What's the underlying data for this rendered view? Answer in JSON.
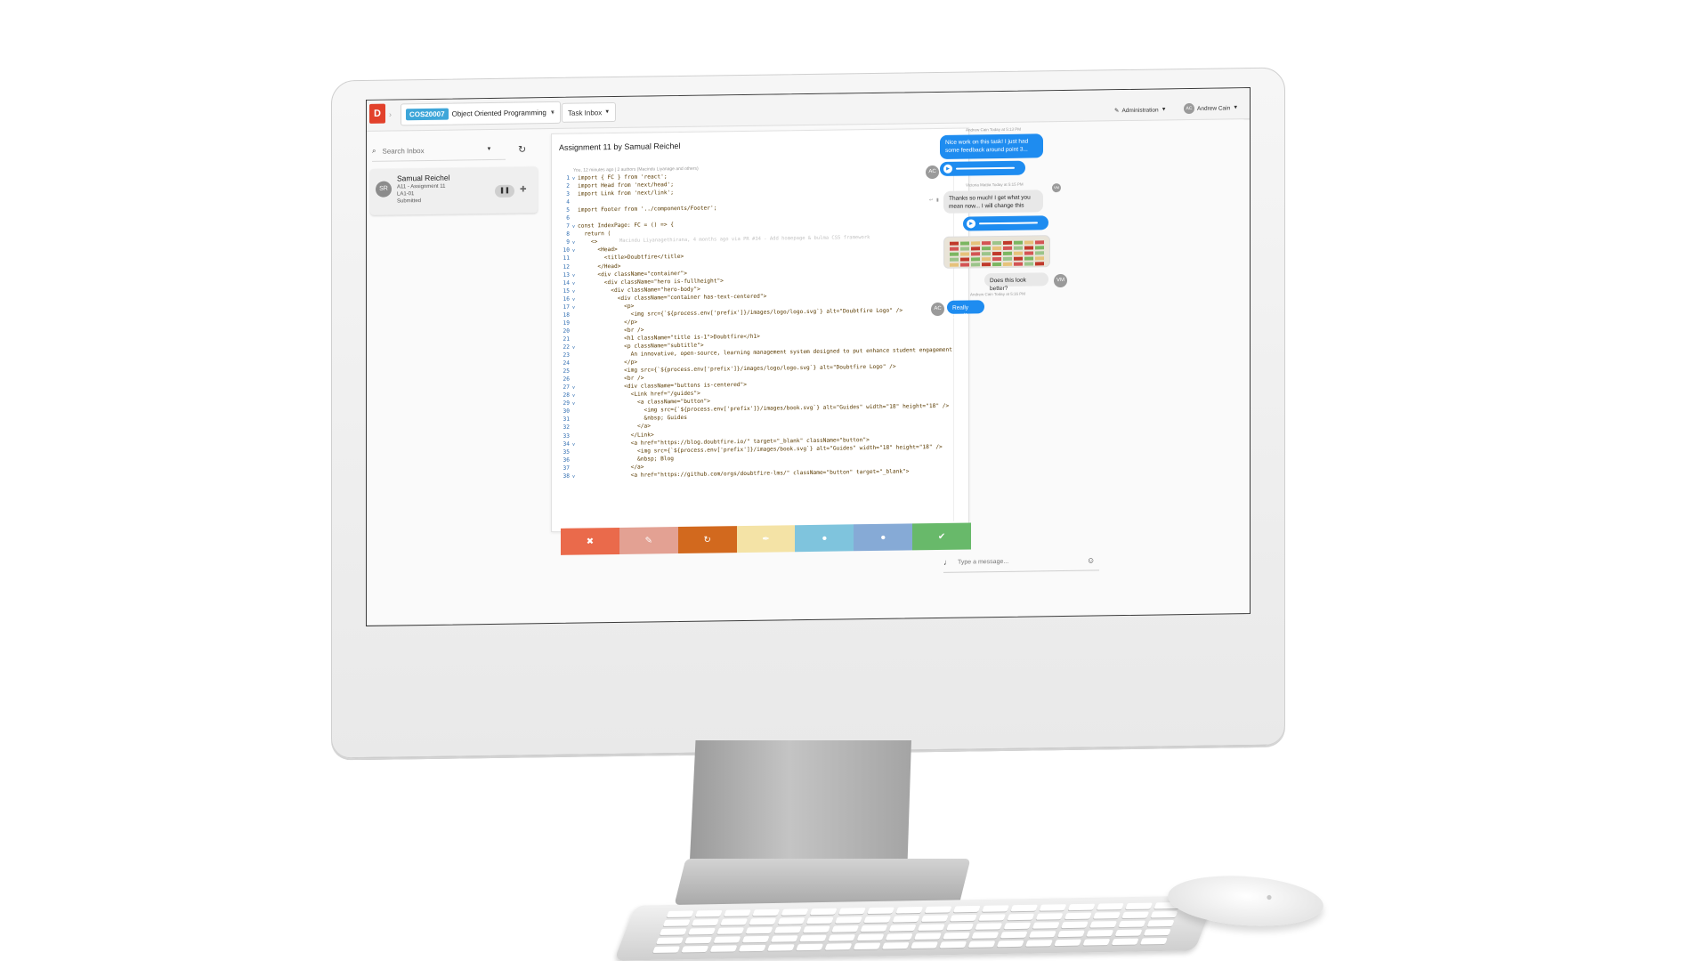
{
  "app": {
    "logo_text": "D",
    "course_code": "COS20007",
    "course_name": "Object Oriented Programming",
    "inbox_label": "Task Inbox",
    "admin_label": "Administration",
    "user_initials": "AC",
    "user_name": "Andrew Cain"
  },
  "inbox": {
    "search_placeholder": "Search Inbox",
    "item": {
      "initials": "SR",
      "name": "Samual Reichel",
      "task": "A11 - Assignment 11",
      "tutorial": "LA1-01",
      "status": "Submitted"
    }
  },
  "task": {
    "title": "Assignment 11 by Samual Reichel",
    "blame": "You, 12 minutes ago | 2 authors (Macindu Liyanage and others)",
    "inline_hint": "Macindu Liyanagethirana, 4 months ago via PR #34 - Add homepage & bulma CSS framework",
    "code_lines": [
      {
        "n": "1",
        "fold": "v",
        "code": "import { FC } from 'react';"
      },
      {
        "n": "2",
        "fold": "",
        "code": "import Head from 'next/head';"
      },
      {
        "n": "3",
        "fold": "",
        "code": "import Link from 'next/link';"
      },
      {
        "n": "4",
        "fold": "",
        "code": ""
      },
      {
        "n": "5",
        "fold": "",
        "code": "import Footer from '../components/Footer';"
      },
      {
        "n": "6",
        "fold": "",
        "code": ""
      },
      {
        "n": "7",
        "fold": "v",
        "code": "const IndexPage: FC = () => {"
      },
      {
        "n": "8",
        "fold": "",
        "code": "  return ("
      },
      {
        "n": "9",
        "fold": "v",
        "code": "    <>"
      },
      {
        "n": "10",
        "fold": "v",
        "code": "      <Head>"
      },
      {
        "n": "11",
        "fold": "",
        "code": "        <title>Doubtfire</title>"
      },
      {
        "n": "12",
        "fold": "",
        "code": "      </Head>"
      },
      {
        "n": "13",
        "fold": "v",
        "code": "      <div className=\"container\">"
      },
      {
        "n": "14",
        "fold": "v",
        "code": "        <div className=\"hero is-fullheight\">"
      },
      {
        "n": "15",
        "fold": "v",
        "code": "          <div className=\"hero-body\">"
      },
      {
        "n": "16",
        "fold": "v",
        "code": "            <div className=\"container has-text-centered\">"
      },
      {
        "n": "17",
        "fold": "v",
        "code": "              <p>"
      },
      {
        "n": "18",
        "fold": "",
        "code": "                <img src={`${process.env['prefix']}/images/logo/logo.svg`} alt=\"Doubtfire Logo\" />"
      },
      {
        "n": "19",
        "fold": "",
        "code": "              </p>"
      },
      {
        "n": "20",
        "fold": "",
        "code": "              <br />"
      },
      {
        "n": "21",
        "fold": "",
        "code": "              <h1 className=\"title is-1\">Doubtfire</h1>"
      },
      {
        "n": "22",
        "fold": "v",
        "code": "              <p className=\"subtitle\">"
      },
      {
        "n": "23",
        "fold": "",
        "code": "                An innovative, open-source, learning management system designed to put enhance student engagement and learning."
      },
      {
        "n": "24",
        "fold": "",
        "code": "              </p>"
      },
      {
        "n": "25",
        "fold": "",
        "code": "              <img src={`${process.env['prefix']}/images/logo/logo.svg`} alt=\"Doubtfire Logo\" />"
      },
      {
        "n": "26",
        "fold": "",
        "code": "              <br />"
      },
      {
        "n": "27",
        "fold": "v",
        "code": "              <div className=\"buttons is-centered\">"
      },
      {
        "n": "28",
        "fold": "v",
        "code": "                <Link href=\"/guides\">"
      },
      {
        "n": "29",
        "fold": "v",
        "code": "                  <a className=\"button\">"
      },
      {
        "n": "30",
        "fold": "",
        "code": "                    <img src={`${process.env['prefix']}/images/book.svg`} alt=\"Guides\" width=\"18\" height=\"18\" />"
      },
      {
        "n": "31",
        "fold": "",
        "code": "                    &nbsp; Guides"
      },
      {
        "n": "32",
        "fold": "",
        "code": "                  </a>"
      },
      {
        "n": "33",
        "fold": "",
        "code": "                </Link>"
      },
      {
        "n": "34",
        "fold": "v",
        "code": "                <a href=\"https://blog.doubtfire.io/\" target=\"_blank\" className=\"button\">"
      },
      {
        "n": "35",
        "fold": "",
        "code": "                  <img src={`${process.env['prefix']}/images/book.svg`} alt=\"Guides\" width=\"18\" height=\"18\" />"
      },
      {
        "n": "36",
        "fold": "",
        "code": "                  &nbsp; Blog"
      },
      {
        "n": "37",
        "fold": "",
        "code": "                </a>"
      },
      {
        "n": "38",
        "fold": "v",
        "code": "                <a href=\"https://github.com/orgs/doubtfire-lms/\" className=\"button\" target=\"_blank\">"
      }
    ]
  },
  "actions": [
    {
      "name": "close",
      "icon": "✖",
      "color": "#ea6a4b"
    },
    {
      "name": "discuss",
      "icon": "✎",
      "color": "#e3a193"
    },
    {
      "name": "redo",
      "icon": "↻",
      "color": "#d2691e"
    },
    {
      "name": "fix",
      "icon": "✒",
      "color": "#f4e3a6"
    },
    {
      "name": "comment",
      "icon": "●",
      "color": "#7fc4dd"
    },
    {
      "name": "chat",
      "icon": "●",
      "color": "#86aad6"
    },
    {
      "name": "complete",
      "icon": "✔",
      "color": "#68b96a"
    }
  ],
  "chat": {
    "t1": "Andrew Cain Today at 5:13 PM",
    "m1": "Nice work on this task! I just had some feedback around point 3...",
    "t2": "Victoria Mattia Today at 5:15 PM",
    "m2": "Thanks so much! I get what you mean now... I will change this",
    "m3": "Does this look better?",
    "t3": "Andrew Cain Today at 5:16 PM",
    "m4": "Really good!",
    "initials_a": "AC",
    "initials_b": "VM",
    "message_placeholder": "Type a message..."
  }
}
